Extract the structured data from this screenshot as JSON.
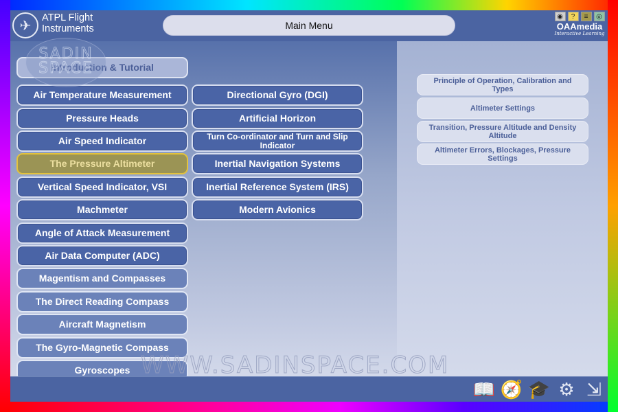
{
  "header": {
    "app_title": "ATPL Flight\nInstruments",
    "logo_icon": "airplane-circle-icon",
    "main_menu_label": "Main Menu",
    "brand": {
      "name": "OAAmedia",
      "tagline": "Interactive Learning",
      "icons": [
        "sound-icon",
        "help-icon",
        "notes-icon",
        "view-icon"
      ]
    }
  },
  "menu": {
    "intro": "Introduction & Tutorial",
    "column1": [
      "Air Temperature Measurement",
      "Pressure Heads",
      "Air Speed Indicator",
      "The Pressure Altimeter",
      "Vertical Speed Indicator, VSI",
      "Machmeter",
      "Angle of Attack Measurement",
      "Air Data Computer (ADC)",
      "Magentism and Compasses",
      "The Direct Reading Compass",
      "Aircraft Magnetism",
      "The Gyro-Magnetic Compass",
      "Gyroscopes"
    ],
    "column2": [
      "Directional Gyro (DGI)",
      "Artificial Horizon",
      "Turn Co-ordinator and Turn and Slip Indicator",
      "Inertial Navigation Systems",
      "Inertial Reference System (IRS)",
      "Modern Avionics"
    ],
    "selected": "The Pressure Altimeter"
  },
  "submenu": [
    "Principle of Operation, Calibration and Types",
    "Altimeter Settings",
    "Transition, Pressure Altitude and Density Altitude",
    "Altimeter Errors, Blockages, Pressure Settings"
  ],
  "footer": {
    "icons": [
      "book-icon",
      "compass-icon",
      "graduation-cap-icon",
      "gears-icon",
      "exit-icon"
    ]
  },
  "watermark": {
    "logo_text": "SADIN\nSPACE",
    "url_text": "WWW.SADINSPACE.COM"
  },
  "colors": {
    "app_blue": "#4b64a2",
    "button_blue": "#4a64a6",
    "selected_gold": "#9b9455",
    "selected_border": "#e3c23c",
    "submenu_bg": "#dadfee",
    "submenu_text": "#4b5f98"
  }
}
